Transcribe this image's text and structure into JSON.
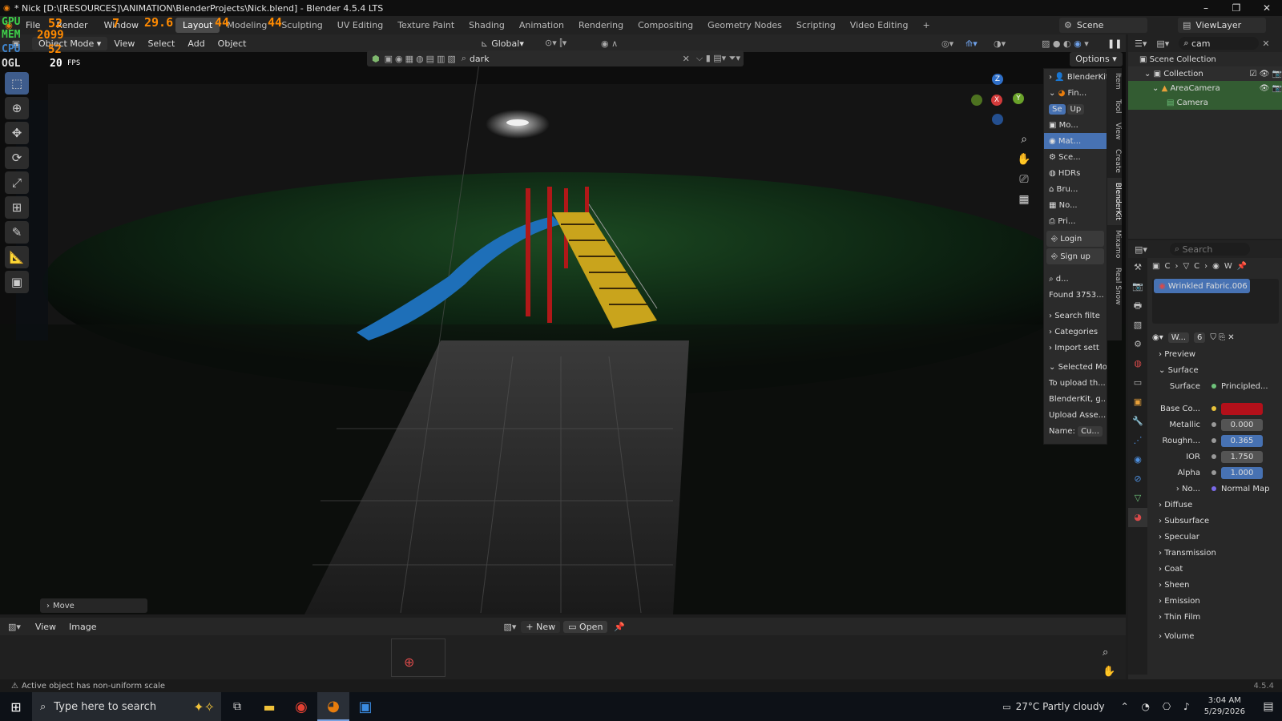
{
  "window": {
    "title": "* Nick [D:\\[RESOURCES]\\ANIMATION\\BlenderProjects\\Nick.blend] - Blender 4.5.4 LTS",
    "min": "–",
    "max": "❐",
    "close": "✕"
  },
  "menu": {
    "items": [
      "File",
      "Render",
      "Window"
    ],
    "workspaces": [
      "Layout",
      "Modeling",
      "Sculpting",
      "UV Editing",
      "Texture Paint",
      "Shading",
      "Animation",
      "Rendering",
      "Compositing",
      "Geometry Nodes",
      "Scripting",
      "Video Editing"
    ],
    "add_ws": "+",
    "scene": "Scene",
    "view_layer": "ViewLayer"
  },
  "stats": {
    "gpu_label": "GPU",
    "gpu_temp": "52",
    "gpu_use": "7",
    "gpu_clock": "29.6",
    "gpu_pct": "44",
    "mem_label": "MEM",
    "mem_val": "2099",
    "cpu_label": "CPU",
    "cpu_temp": "52",
    "cpu_pct": "44",
    "ogl_label": "OGL",
    "fps_val": "20",
    "fps_label": "FPS"
  },
  "viewport_header": {
    "mode": "Object Mode",
    "items": [
      "View",
      "Select",
      "Add",
      "Object"
    ],
    "orientation": "Global",
    "options": "Options"
  },
  "search": {
    "query": "dark"
  },
  "gizmo": {
    "z": "Z",
    "x": "X",
    "y": "Y"
  },
  "blenderkit": {
    "header": "BlenderKit",
    "find": "Fin...",
    "tabs": [
      "Se",
      "Up"
    ],
    "asset_types": [
      "Mo...",
      "Mat...",
      "Sce...",
      "HDRs",
      "Bru...",
      "No...",
      "Pri..."
    ],
    "login": "Login",
    "signup": "Sign up",
    "search_short": "d...",
    "found": "Found 3753...",
    "sections": [
      "Search filte",
      "Categories",
      "Import sett"
    ],
    "selected_model": "Selected Mod",
    "upload_hint": "To upload th...",
    "bk_g": "BlenderKit, g...",
    "upload_asset": "Upload Asse...",
    "name_label": "Name:",
    "name_val": "Cu..."
  },
  "side_tabs": [
    "Item",
    "Tool",
    "View",
    "Create",
    "BlenderKit",
    "Mixamo",
    "Real Snow"
  ],
  "outliner": {
    "search": "cam",
    "scene_collection": "Scene Collection",
    "collection": "Collection",
    "area_camera": "AreaCamera",
    "camera": "Camera"
  },
  "properties": {
    "search_placeholder": "Search",
    "breadcrumb": [
      "C",
      "C",
      "W"
    ],
    "material": "Wrinkled Fabric.006",
    "mat_short": "W...",
    "users": "6",
    "preview": "Preview",
    "surface_section": "Surface",
    "surface_label": "Surface",
    "surface_val": "Principled...",
    "fields": [
      {
        "label": "Base Co...",
        "val": ""
      },
      {
        "label": "Metallic",
        "val": "0.000"
      },
      {
        "label": "Roughn...",
        "val": "0.365"
      },
      {
        "label": "IOR",
        "val": "1.750"
      },
      {
        "label": "Alpha",
        "val": "1.000"
      }
    ],
    "normal_label": "No...",
    "normal_val": "Normal Map",
    "subsections": [
      "Diffuse",
      "Subsurface",
      "Specular",
      "Transmission",
      "Coat",
      "Sheen",
      "Emission",
      "Thin Film"
    ],
    "volume": "Volume",
    "version": "4.5.4",
    "base_color": "#b3101a"
  },
  "image_editor": {
    "items": [
      "View",
      "Image"
    ],
    "new": "New",
    "open": "Open"
  },
  "operator": "Move",
  "status": {
    "message": "Active object has non-uniform scale"
  },
  "taskbar": {
    "search": "Type here to search",
    "weather": "27°C  Partly cloudy",
    "time": "3:04 AM",
    "date": "5/29/2026"
  }
}
